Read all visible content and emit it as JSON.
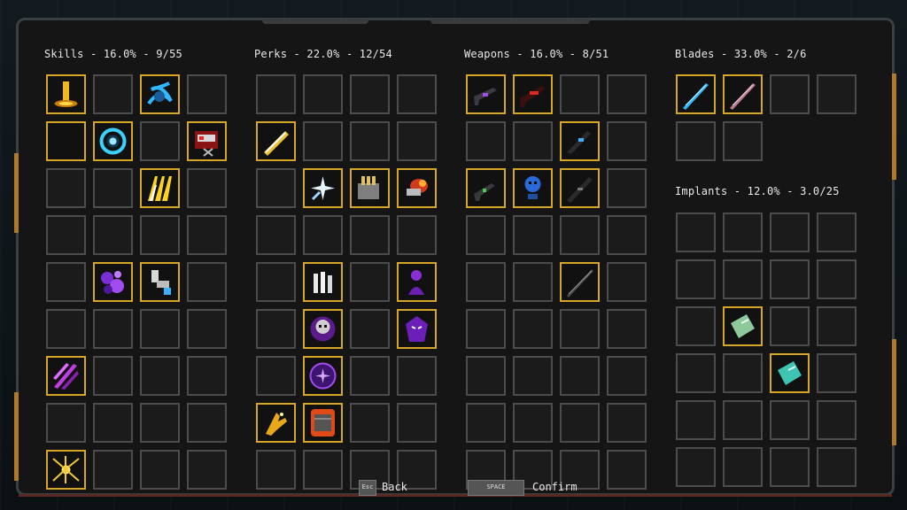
{
  "sections": {
    "skills": {
      "title": "Skills - 16.0% - 9/55"
    },
    "perks": {
      "title": "Perks - 22.0% - 12/54"
    },
    "weapons": {
      "title": "Weapons - 16.0% - 8/51"
    },
    "blades": {
      "title": "Blades - 33.0% - 2/6"
    },
    "implants": {
      "title": "Implants - 12.0% - 3.0/25"
    }
  },
  "footer": {
    "back_key": "Esc",
    "back_label": "Back",
    "confirm_key": "SPACE",
    "confirm_label": "Confirm"
  },
  "colors": {
    "owned_border": "#d6a626",
    "empty_border": "#4c4c4c",
    "frame": "#3a3f44"
  },
  "items": {
    "skills": [
      {
        "r": 0,
        "c": 0,
        "icon": "golden-beam-skill-icon"
      },
      {
        "r": 0,
        "c": 2,
        "icon": "blue-vortex-skill-icon"
      },
      {
        "r": 1,
        "c": 0,
        "icon": "empty-owned-slot"
      },
      {
        "r": 1,
        "c": 1,
        "icon": "cyan-ring-skill-icon"
      },
      {
        "r": 1,
        "c": 3,
        "icon": "red-robot-skill-icon"
      },
      {
        "r": 2,
        "c": 2,
        "icon": "yellow-claw-skill-icon"
      },
      {
        "r": 4,
        "c": 1,
        "icon": "purple-orbs-skill-icon"
      },
      {
        "r": 4,
        "c": 2,
        "icon": "mech-arm-skill-icon"
      },
      {
        "r": 6,
        "c": 0,
        "icon": "purple-slash-skill-icon"
      },
      {
        "r": 8,
        "c": 0,
        "icon": "golden-spider-skill-icon"
      }
    ],
    "perks": [
      {
        "r": 1,
        "c": 0,
        "icon": "golden-blade-perk-icon"
      },
      {
        "r": 2,
        "c": 1,
        "icon": "sparkle-perk-icon"
      },
      {
        "r": 2,
        "c": 2,
        "icon": "ammo-box-perk-icon"
      },
      {
        "r": 2,
        "c": 3,
        "icon": "fire-bullet-perk-icon"
      },
      {
        "r": 4,
        "c": 1,
        "icon": "bullets-perk-icon"
      },
      {
        "r": 4,
        "c": 3,
        "icon": "purple-figure-perk-icon"
      },
      {
        "r": 5,
        "c": 1,
        "icon": "skull-perk-icon"
      },
      {
        "r": 5,
        "c": 3,
        "icon": "purple-mask-perk-icon"
      },
      {
        "r": 6,
        "c": 1,
        "icon": "purple-star-perk-icon"
      },
      {
        "r": 7,
        "c": 0,
        "icon": "golden-hand-perk-icon"
      },
      {
        "r": 7,
        "c": 1,
        "icon": "fire-barrel-perk-icon"
      }
    ],
    "weapons": [
      {
        "r": 0,
        "c": 0,
        "icon": "purple-gun-weapon-icon"
      },
      {
        "r": 0,
        "c": 1,
        "icon": "red-rifle-weapon-icon"
      },
      {
        "r": 1,
        "c": 2,
        "icon": "blue-rifle-weapon-icon"
      },
      {
        "r": 2,
        "c": 0,
        "icon": "green-smg-weapon-icon"
      },
      {
        "r": 2,
        "c": 1,
        "icon": "blue-skull-weapon-icon"
      },
      {
        "r": 2,
        "c": 2,
        "icon": "black-rifle-weapon-icon"
      },
      {
        "r": 4,
        "c": 2,
        "icon": "long-blade-weapon-icon"
      }
    ],
    "blades": [
      {
        "r": 0,
        "c": 0,
        "icon": "cyan-sword-blade-icon"
      },
      {
        "r": 0,
        "c": 1,
        "icon": "pink-sword-blade-icon"
      }
    ],
    "implants": [
      {
        "r": 2,
        "c": 1,
        "icon": "green-chip-implant-icon"
      },
      {
        "r": 3,
        "c": 2,
        "icon": "teal-chip-implant-icon"
      }
    ]
  }
}
